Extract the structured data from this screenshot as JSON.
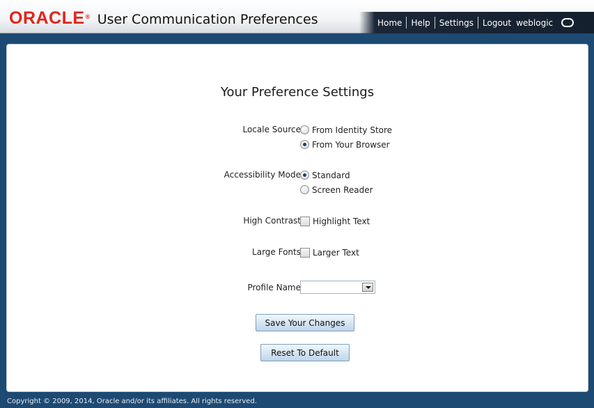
{
  "header": {
    "logo_text": "ORACLE",
    "logo_mark": "®",
    "app_title": "User Communication Preferences",
    "nav": {
      "home": "Home",
      "help": "Help",
      "settings": "Settings",
      "logout": "Logout",
      "user": "weblogic"
    }
  },
  "main": {
    "title": "Your Preference Settings",
    "locale_source": {
      "label": "Locale Source",
      "options": [
        {
          "label": "From Identity Store",
          "selected": false
        },
        {
          "label": "From Your Browser",
          "selected": true
        }
      ]
    },
    "accessibility_mode": {
      "label": "Accessibility Mode",
      "options": [
        {
          "label": "Standard",
          "selected": true
        },
        {
          "label": "Screen Reader",
          "selected": false
        }
      ]
    },
    "high_contrast": {
      "label": "High Contrast",
      "option": "Highlight Text",
      "checked": false
    },
    "large_fonts": {
      "label": "Large Fonts",
      "option": "Larger Text",
      "checked": false
    },
    "profile_name": {
      "label": "Profile Name",
      "value": ""
    },
    "save_button": "Save Your Changes",
    "reset_button": "Reset To Default"
  },
  "footer": {
    "copyright": "Copyright © 2009, 2014, Oracle and/or its affiliates. All rights reserved."
  },
  "colors": {
    "brand_red": "#e2231a",
    "nav_bg": "#14202e",
    "page_bg": "#1d4a72",
    "button_border": "#7f9db9"
  }
}
